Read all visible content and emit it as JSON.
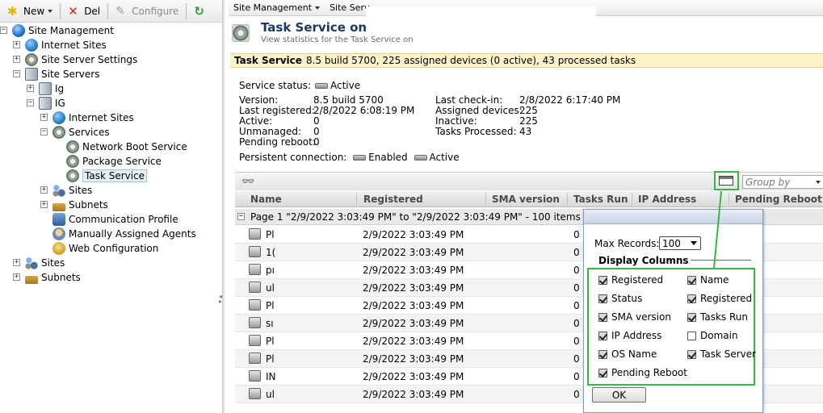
{
  "toolbar": {
    "new_label": "New",
    "del_label": "Del",
    "configure_label": "Configure"
  },
  "tree": {
    "site_management": "Site Management",
    "internet_sites": "Internet Sites",
    "site_server_settings": "Site Server Settings",
    "site_servers": "Site Servers",
    "server1": "Ig",
    "server2": "IG",
    "srv_internet_sites": "Internet Sites",
    "services": "Services",
    "network_boot_service": "Network Boot Service",
    "package_service": "Package Service",
    "task_service": "Task Service",
    "sites_sub": "Sites",
    "subnets_sub": "Subnets",
    "communication_profile": "Communication Profile",
    "manually_assigned_agents": "Manually Assigned Agents",
    "web_configuration": "Web Configuration",
    "sites": "Sites",
    "subnets": "Subnets"
  },
  "breadcrumb": {
    "site_management": "Site Management",
    "site_servers": "Site Serv"
  },
  "header": {
    "title": "Task Service on",
    "subtitle": "View statistics for the Task Service on"
  },
  "infobar": {
    "label": "Task Service",
    "text": "8.5 build 5700, 225 assigned devices (0 active), 43 processed tasks"
  },
  "details": {
    "service_status_label": "Service status:",
    "service_status_value": "Active",
    "version_label": "Version:",
    "version_value": "8.5 build 5700",
    "last_registered_label": "Last registered:",
    "last_registered_value": "2/8/2022 6:08:19 PM",
    "active_label": "Active:",
    "active_value": "0",
    "unmanaged_label": "Unmanaged:",
    "unmanaged_value": "0",
    "pending_reboot_label": "Pending reboot:",
    "pending_reboot_value": "0",
    "last_checkin_label": "Last check-in:",
    "last_checkin_value": "2/8/2022 6:17:40 PM",
    "assigned_devices_label": "Assigned devices:",
    "assigned_devices_value": "225",
    "inactive_label": "Inactive:",
    "inactive_value": "225",
    "tasks_processed_label": "Tasks Processed:",
    "tasks_processed_value": "43",
    "persistent_label": "Persistent connection:",
    "persistent_enabled": "Enabled",
    "persistent_active": "Active"
  },
  "grid": {
    "group_by_placeholder": "Group by",
    "columns": [
      "Name",
      "Registered",
      "SMA version",
      "Tasks Run",
      "IP Address",
      "Pending Reboot"
    ],
    "group_row": "Page 1 \"2/9/2022 3:03:49 PM\" to \"2/9/2022 3:03:49 PM\" - 100 items",
    "rows": [
      {
        "name": "Pl",
        "registered": "2/9/2022 3:03:49 PM",
        "tasks": "0"
      },
      {
        "name": "1(",
        "registered": "2/9/2022 3:03:49 PM",
        "tasks": "0"
      },
      {
        "name": "pı",
        "registered": "2/9/2022 3:03:49 PM",
        "tasks": "0"
      },
      {
        "name": "ul",
        "registered": "2/9/2022 3:03:49 PM",
        "tasks": "0"
      },
      {
        "name": "Pl",
        "registered": "2/9/2022 3:03:49 PM",
        "tasks": "0"
      },
      {
        "name": "sı",
        "registered": "2/9/2022 3:03:49 PM",
        "tasks": "0"
      },
      {
        "name": "Pl",
        "registered": "2/9/2022 3:03:49 PM",
        "tasks": "0"
      },
      {
        "name": "Pl",
        "registered": "2/9/2022 3:03:49 PM",
        "tasks": "0"
      },
      {
        "name": "IN",
        "registered": "2/9/2022 3:03:49 PM",
        "tasks": "0"
      },
      {
        "name": "ul",
        "registered": "2/9/2022 3:03:49 PM",
        "tasks": "0"
      }
    ]
  },
  "popup": {
    "max_records_label": "Max Records:",
    "max_records_value": "100",
    "display_columns_label": "Display Columns",
    "options": [
      {
        "label": "Registered",
        "checked": true
      },
      {
        "label": "Name",
        "checked": true
      },
      {
        "label": "Status",
        "checked": true
      },
      {
        "label": "Registered",
        "checked": true
      },
      {
        "label": "SMA version",
        "checked": true
      },
      {
        "label": "Tasks Run",
        "checked": true
      },
      {
        "label": "IP Address",
        "checked": true
      },
      {
        "label": "Domain",
        "checked": false
      },
      {
        "label": "OS Name",
        "checked": true
      },
      {
        "label": "Task Server",
        "checked": true
      },
      {
        "label": "Pending Reboot",
        "checked": true
      }
    ],
    "ok_label": "OK"
  },
  "colors": {
    "highlight_green": "#3cb34a",
    "info_bar": "#fdf3c8",
    "title_blue": "#1b3764"
  }
}
